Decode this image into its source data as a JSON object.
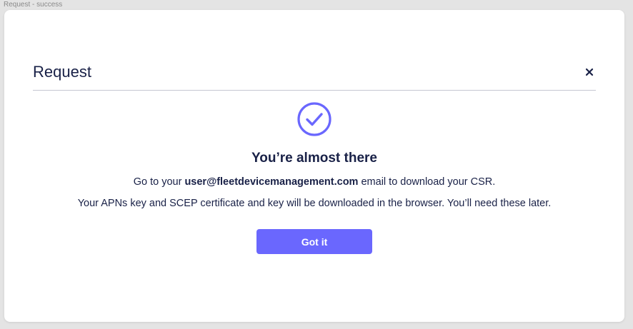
{
  "frame": {
    "label": "Request - success"
  },
  "modal": {
    "title": "Request",
    "close_icon": "close-icon",
    "status_icon": "check-circle-icon",
    "headline": "You’re almost there",
    "line1": {
      "prefix": "Go to your ",
      "email": "user@fleetdevicemanagement.com",
      "suffix": " email to download your CSR."
    },
    "line2": "Your APNs key and SCEP certificate and key will be downloaded in the browser. You’ll need these later.",
    "button_label": "Got it"
  },
  "colors": {
    "accent": "#6a67fe",
    "text": "#192147",
    "divider": "#c5c7d1",
    "backdrop": "#e4e4e4"
  }
}
